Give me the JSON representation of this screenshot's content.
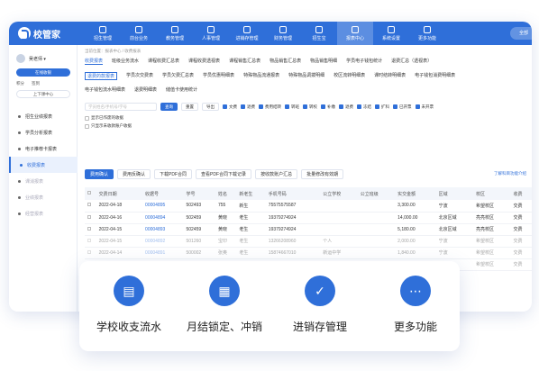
{
  "app": {
    "logo": "校管家",
    "user_button": "全部"
  },
  "nav": [
    {
      "label": "招生管理"
    },
    {
      "label": "前台业务"
    },
    {
      "label": "教务管理"
    },
    {
      "label": "人事管理"
    },
    {
      "label": "进销存管理"
    },
    {
      "label": "财务管理"
    },
    {
      "label": "招生宝"
    },
    {
      "label": "报表中心",
      "active": true
    },
    {
      "label": "系统设置"
    },
    {
      "label": "更多功能"
    }
  ],
  "sidebar": {
    "user_name": "吴老师 ▾",
    "online": "在线收银",
    "points": "积分",
    "sign": "签到",
    "class_btn": "上下课中心",
    "items": [
      {
        "label": "招生业绩报表"
      },
      {
        "label": "学员分析报表"
      },
      {
        "label": "电子推荐卡报表"
      },
      {
        "label": "收费报表",
        "active": true
      },
      {
        "label": "课消报表"
      },
      {
        "label": "业绩报表"
      },
      {
        "label": "经营报表"
      }
    ]
  },
  "main": {
    "breadcrumb": "当前位置：报表中心 / 收费报表",
    "tabs1": [
      "收费报表",
      "班级业务流水",
      "课程收费汇总表",
      "课程收费透视表",
      "课程销售汇总表",
      "物品销售汇总表",
      "物品销售明细",
      "学员电子钱包统计",
      "退费汇总（透视表）"
    ],
    "tabs2": [
      "退费的款报表",
      "学员次交费表",
      "学员欠费汇总表",
      "学员优惠明细表",
      "特殊物品流通报表",
      "特殊物品调拨明细",
      "校区流转明细表",
      "课时结转明细表",
      "电子钱包消费明细表"
    ],
    "tabs3": [
      "电子钱包流水明细表",
      "退费明细表",
      "储值卡使用统计"
    ],
    "search_placeholder": "学员姓名/手机号/学号",
    "query_btn": "查询",
    "reset_btn": "重置",
    "export_btn": "导出",
    "filters": [
      {
        "label": "文费",
        "on": true
      },
      {
        "label": "退费",
        "on": true
      },
      {
        "label": "费用结转",
        "on": true
      },
      {
        "label": "转班",
        "on": true
      },
      {
        "label": "转校",
        "on": true
      },
      {
        "label": "补缴",
        "on": true
      },
      {
        "label": "退费",
        "on": true
      },
      {
        "label": "冻结",
        "on": true
      },
      {
        "label": "扩科",
        "on": true
      },
      {
        "label": "已开票",
        "on": true
      },
      {
        "label": "未开票",
        "on": true
      }
    ],
    "opt1": "显示已作废的收据",
    "opt2": "只显示未收款账户收据",
    "toolbar": [
      "费用确认",
      "费用反确认",
      "下载PDF合同",
      "查看PDF合同下载记录",
      "按收款账户汇总",
      "批量修改有效期"
    ],
    "help_link": "了解科目功能介绍",
    "columns": [
      "",
      "交费日期",
      "收据号",
      "学号",
      "姓名",
      "新老生",
      "手机号码",
      "公立学校",
      "公立班级",
      "实交金额",
      "区域",
      "校区",
      "收费"
    ],
    "rows": [
      {
        "date": "2022-04-18",
        "receipt": "00004895",
        "sid": "502493",
        "name": "755",
        "type": "新生",
        "phone": "75575575587",
        "school": "",
        "cls": "",
        "amount": "3,300.00",
        "area": "宁波",
        "campus": "希望校区",
        "fee": "交费"
      },
      {
        "date": "2022-04-16",
        "receipt": "00004894",
        "sid": "502459",
        "name": "黄晓",
        "type": "老生",
        "phone": "19379274924",
        "school": "",
        "cls": "",
        "amount": "14,000.00",
        "area": "北京区域",
        "campus": "亮亮校区",
        "fee": "交费"
      },
      {
        "date": "2022-04-15",
        "receipt": "00004893",
        "sid": "502459",
        "name": "黄晓",
        "type": "老生",
        "phone": "19379274924",
        "school": "",
        "cls": "",
        "amount": "5,180.00",
        "area": "北京区域",
        "campus": "亮亮校区",
        "fee": "交费"
      },
      {
        "date": "2022-04-15",
        "receipt": "00004892",
        "sid": "501260",
        "name": "宝印",
        "type": "老生",
        "phone": "13266208960",
        "school": "个人",
        "cls": "",
        "amount": "2,000.00",
        "area": "宁波",
        "campus": "希望校区",
        "fee": "交费"
      },
      {
        "date": "2022-04-14",
        "receipt": "00004891",
        "sid": "500002",
        "name": "张奥",
        "type": "老生",
        "phone": "15874667010",
        "school": "新运中学",
        "cls": "",
        "amount": "1,840.00",
        "area": "宁波",
        "campus": "希望校区",
        "fee": "交费"
      },
      {
        "date": "2022-04-14",
        "receipt": "00004890",
        "sid": "502317",
        "name": "贝",
        "type": "老生",
        "phone": "18079975958",
        "school": "",
        "cls": "",
        "amount": "1,062.00",
        "area": "宁波",
        "campus": "希望校区",
        "fee": "交费"
      }
    ]
  },
  "features": [
    {
      "label": "学校收支流水",
      "icon": "document-icon"
    },
    {
      "label": "月结锁定、冲销",
      "icon": "calendar-lock-icon"
    },
    {
      "label": "进销存管理",
      "icon": "checklist-icon"
    },
    {
      "label": "更多功能",
      "icon": "more-icon"
    }
  ],
  "colors": {
    "primary": "#2f6fd9"
  }
}
